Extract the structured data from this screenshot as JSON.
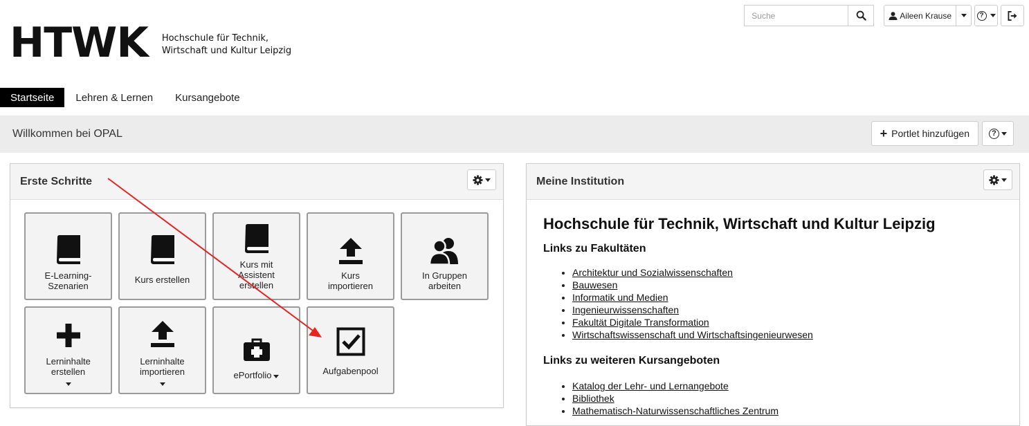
{
  "header": {
    "logo_text": "HTWK",
    "logo_sub_line1": "Hochschule für Technik,",
    "logo_sub_line2": "Wirtschaft und Kultur Leipzig",
    "search_placeholder": "Suche",
    "user_name": "Aileen Krause"
  },
  "nav": {
    "items": [
      {
        "label": "Startseite"
      },
      {
        "label": "Lehren & Lernen"
      },
      {
        "label": "Kursangebote"
      }
    ]
  },
  "welcome": {
    "title": "Willkommen bei OPAL",
    "add_portlet_label": "Portlet hinzufügen"
  },
  "portlet_first_steps": {
    "title": "Erste Schritte",
    "tiles": [
      {
        "label": "E-Learning-Szenarien",
        "icon": "book-icon"
      },
      {
        "label": "Kurs erstellen",
        "icon": "book-icon"
      },
      {
        "label": "Kurs mit Assistent erstellen",
        "icon": "book-icon"
      },
      {
        "label": "Kurs importieren",
        "icon": "upload-icon"
      },
      {
        "label": "In Gruppen arbeiten",
        "icon": "group-icon"
      },
      {
        "label": "Lerninhalte erstellen",
        "icon": "plus-icon"
      },
      {
        "label": "Lerninhalte importieren",
        "icon": "upload-icon"
      },
      {
        "label": "ePortfolio",
        "icon": "briefcase-icon"
      },
      {
        "label": "Aufgabenpool",
        "icon": "checkbox-icon"
      }
    ]
  },
  "portlet_institution": {
    "title": "Meine Institution",
    "heading": "Hochschule für Technik, Wirtschaft und Kultur Leipzig",
    "faculties_heading": "Links zu Fakultäten",
    "faculties": [
      "Architektur und Sozialwissenschaften",
      "Bauwesen",
      "Informatik und Medien",
      "Ingenieurwissenschaften",
      "Fakultät Digitale Transformation",
      "Wirtschaftswissenschaft und Wirtschaftsingenieurwesen"
    ],
    "courses_heading": "Links zu weiteren Kursangeboten",
    "courses": [
      "Katalog der Lehr- und Lernangebote",
      "Bibliothek",
      "Mathematisch-Naturwissenschaftliches Zentrum"
    ]
  },
  "colors": {
    "nav_active_bg": "#000000",
    "welcome_bg": "#ececec",
    "tile_border": "#9a9a9a",
    "annotation_arrow": "#e8231f"
  }
}
